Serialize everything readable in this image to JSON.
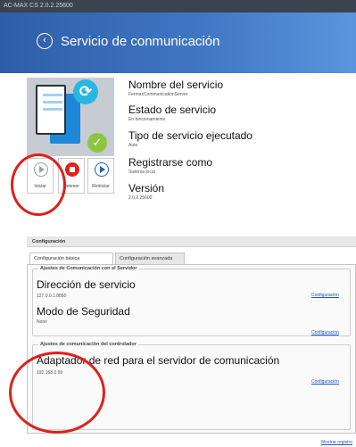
{
  "window": {
    "title": "AC-MAX CS 2.0.2.25600"
  },
  "header": {
    "title": "Servicio de conmunicación",
    "back_icon": "‹"
  },
  "service_icon": {
    "refresh_glyph": "⟳",
    "check_glyph": "✓"
  },
  "controls": {
    "start_label": "Iniciar",
    "stop_label": "Detener",
    "restart_label": "Reiniciar"
  },
  "info": [
    {
      "label": "Nombre del servicio",
      "value": "FermaxCommunicationServer"
    },
    {
      "label": "Estado de servicio",
      "value": "En funcionamiento"
    },
    {
      "label": "Tipo de servicio ejecutado",
      "value": "Auto"
    },
    {
      "label": "Registrarse como",
      "value": "Sistema local"
    },
    {
      "label": "Versión",
      "value": "2.0.2.25600"
    }
  ],
  "configuration": {
    "section_title": "Configuración",
    "tabs": [
      "Configuración básica",
      "Configuración avanzada"
    ],
    "server_group": {
      "title": "Ajustes de Comunicación con el Servidor",
      "address_label": "Dirección de servicio",
      "address_value": "127.0.0.1:8890",
      "security_label": "Modo de Seguridad",
      "security_value": "None",
      "link": "Configuración"
    },
    "controller_group": {
      "title": "Ajustes de comunicación del controlador",
      "adapter_label": "Adaptador de red para el servidor de comunicación",
      "adapter_value": "192.168.0.99",
      "link": "Configuración"
    }
  },
  "footer": {
    "show_register": "Mostrar registro"
  },
  "colors": {
    "header": "#3f76c4",
    "annotation": "#e0201c",
    "link": "#1a55c0"
  }
}
